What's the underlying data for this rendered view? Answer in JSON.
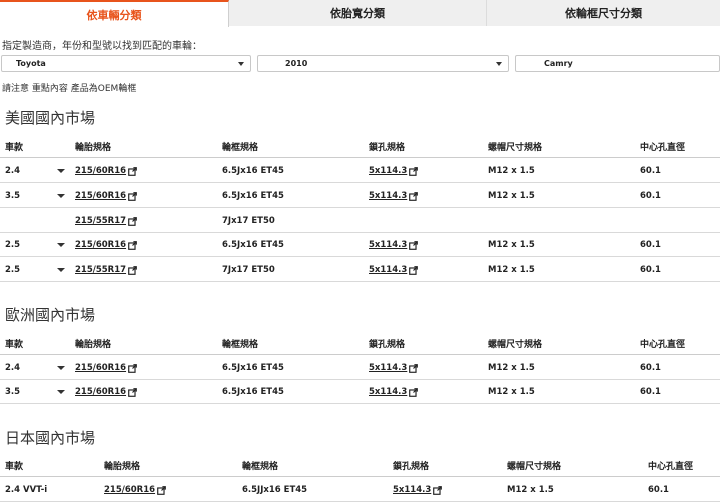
{
  "tabs": [
    {
      "label": "依車輛分類"
    },
    {
      "label": "依胎寬分類"
    },
    {
      "label": "依輪框尺寸分類"
    }
  ],
  "instruction": "指定製造商，年份和型號以找到匹配的車輪：",
  "selects": {
    "make": "Toyota",
    "year": "2010",
    "model": "Camry"
  },
  "note": {
    "prefix": "請注意",
    "emphasis": "重點內容",
    "suffix": "產品為OEM輪框"
  },
  "columns": [
    "車款",
    "輪胎規格",
    "輪框規格",
    "鎖孔規格",
    "螺帽尺寸規格",
    "中心孔直徑"
  ],
  "sections": [
    {
      "title": "美國國內市場",
      "rows": [
        {
          "trim": "2.4",
          "tire": "215/60R16",
          "rim": "6.5Jx16 ET45",
          "bolt": "5x114.3",
          "thread": "M12 x 1.5",
          "cb": "60.1"
        },
        {
          "trim": "3.5",
          "tire": "215/60R16",
          "rim": "6.5Jx16 ET45",
          "bolt": "5x114.3",
          "thread": "M12 x 1.5",
          "cb": "60.1"
        },
        {
          "trim": "",
          "tire": "215/55R17",
          "rim": "7Jx17 ET50",
          "bolt": "",
          "thread": "",
          "cb": ""
        },
        {
          "trim": "2.5",
          "tire": "215/60R16",
          "rim": "6.5Jx16 ET45",
          "bolt": "5x114.3",
          "thread": "M12 x 1.5",
          "cb": "60.1"
        },
        {
          "trim": "2.5",
          "tire": "215/55R17",
          "rim": "7Jx17 ET50",
          "bolt": "5x114.3",
          "thread": "M12 x 1.5",
          "cb": "60.1"
        }
      ]
    },
    {
      "title": "歐洲國內市場",
      "rows": [
        {
          "trim": "2.4",
          "tire": "215/60R16",
          "rim": "6.5Jx16 ET45",
          "bolt": "5x114.3",
          "thread": "M12 x 1.5",
          "cb": "60.1"
        },
        {
          "trim": "3.5",
          "tire": "215/60R16",
          "rim": "6.5Jx16 ET45",
          "bolt": "5x114.3",
          "thread": "M12 x 1.5",
          "cb": "60.1"
        }
      ]
    },
    {
      "title": "日本國內市場",
      "rows": [
        {
          "trim": "2.4 VVT-i",
          "tire": "215/60R16",
          "rim": "6.5JJx16 ET45",
          "bolt": "5x114.3",
          "thread": "M12 x 1.5",
          "cb": "60.1"
        }
      ]
    }
  ],
  "colors": {
    "accent": "#e8541c",
    "tab_bg": "#efefef",
    "border": "#cccccc"
  }
}
